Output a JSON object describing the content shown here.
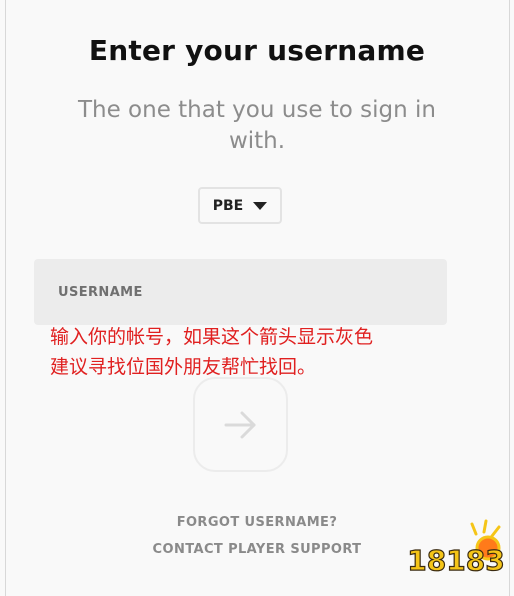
{
  "login": {
    "title": "Enter your username",
    "subtitle": "The one that you use to sign in\nwith.",
    "region": {
      "selected": "PBE",
      "icon": "caret-down-icon"
    },
    "username_placeholder": "USERNAME",
    "submit_icon": "arrow-right-icon",
    "forgot_username": "FORGOT USERNAME?",
    "contact_support": "CONTACT PLAYER SUPPORT"
  },
  "annotation": {
    "text": "输入你的帐号，如果这个箭头显示灰色\n建议寻找位国外朋友帮忙找回。",
    "color": "#e02020"
  },
  "watermark": {
    "text": "18183",
    "colors": [
      "#f5c518",
      "#ff7a1a"
    ]
  }
}
